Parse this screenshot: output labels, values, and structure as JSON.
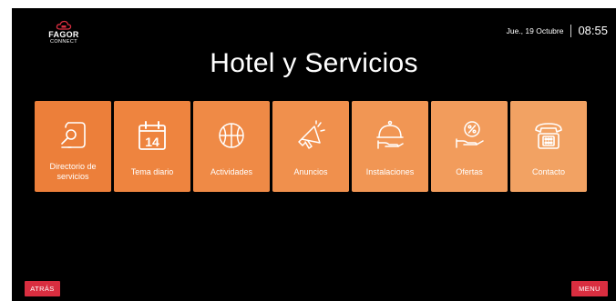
{
  "logo": {
    "brand": "FAGOR",
    "sub": "CONNECT"
  },
  "header": {
    "date": "Jue., 19 Octubre",
    "time": "08:55"
  },
  "title": "Hotel y Servicios",
  "tiles": [
    {
      "label": "Directorio de servicios",
      "icon": "directory-icon",
      "color": "#ec7f3a"
    },
    {
      "label": "Tema diario",
      "icon": "calendar-icon",
      "color": "#ee843f"
    },
    {
      "label": "Actividades",
      "icon": "basketball-icon",
      "color": "#ef8a46"
    },
    {
      "label": "Anuncios",
      "icon": "megaphone-icon",
      "color": "#f0904d"
    },
    {
      "label": "Instalaciones",
      "icon": "cloche-icon",
      "color": "#f19654"
    },
    {
      "label": "Ofertas",
      "icon": "offer-icon",
      "color": "#f29c5c"
    },
    {
      "label": "Contacto",
      "icon": "phone-icon",
      "color": "#f2a263"
    }
  ],
  "calendar_day": "14",
  "footer": {
    "back_label": "ATRÁS",
    "menu_label": "MENU"
  },
  "colors": {
    "background": "#000000",
    "tile_accent": "#ee843f",
    "button": "#d92e40"
  }
}
